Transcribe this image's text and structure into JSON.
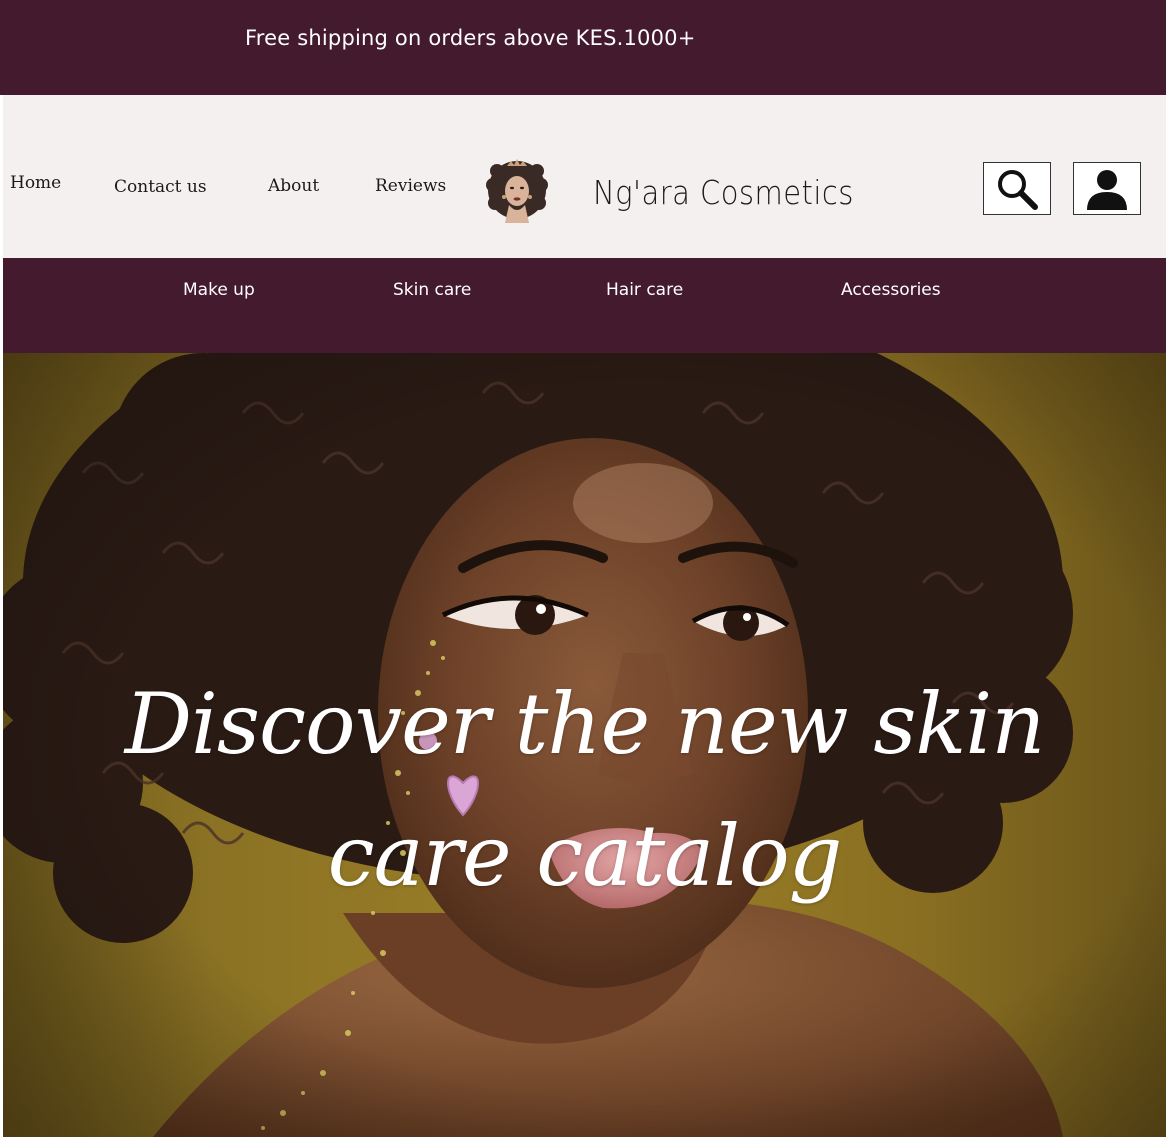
{
  "promo": {
    "text": "Free shipping on orders above KES.1000+"
  },
  "header": {
    "nav": {
      "home": "Home",
      "contact": "Contact us",
      "about": "About",
      "reviews": "Reviews"
    },
    "brand": "Ng'ara Cosmetics",
    "icons": {
      "search": "search-icon",
      "account": "user-icon",
      "logo": "woman-silhouette-logo"
    }
  },
  "categories": {
    "makeup": "Make up",
    "skincare": "Skin care",
    "haircare": "Hair care",
    "accessories": "Accessories"
  },
  "hero": {
    "line1": "Discover the new skin",
    "line2": "care catalog"
  },
  "colors": {
    "brand_primary": "#441a2e",
    "header_bg": "#f3f0ef",
    "hero_backdrop": "#9c8128"
  }
}
